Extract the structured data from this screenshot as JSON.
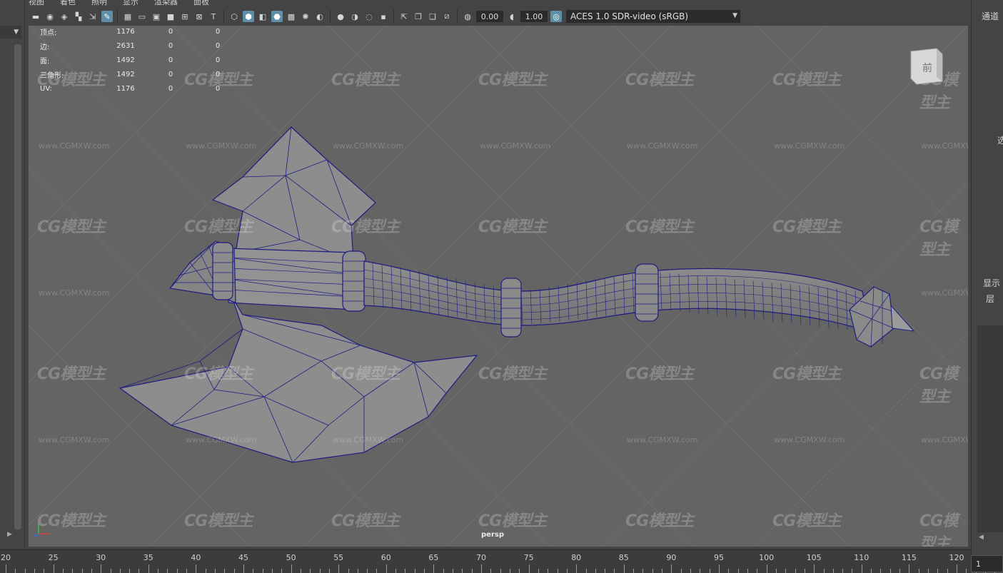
{
  "menu": [
    "视图",
    "着色",
    "照明",
    "显示",
    "渲染器",
    "面板"
  ],
  "toolbar": {
    "exposure": "0.00",
    "gamma": "1.00",
    "color_space": "ACES 1.0 SDR-video (sRGB)"
  },
  "hud": {
    "rows": [
      {
        "label": "顶点:",
        "v1": "1176",
        "v2": "0",
        "v3": "0"
      },
      {
        "label": "边:",
        "v1": "2631",
        "v2": "0",
        "v3": "0"
      },
      {
        "label": "面:",
        "v1": "1492",
        "v2": "0",
        "v3": "0"
      },
      {
        "label": "三角形:",
        "v1": "1492",
        "v2": "0",
        "v3": "0"
      },
      {
        "label": "UV:",
        "v1": "1176",
        "v2": "0",
        "v3": "0"
      }
    ]
  },
  "viewport": {
    "camera": "persp",
    "watermark": "CG模型主",
    "watermark_url": "www.CGMXW.com"
  },
  "right_panel": {
    "channels": "通道",
    "display": "显示",
    "layers": "层",
    "partial": "选"
  },
  "timeline": {
    "ticks": [
      "20",
      "25",
      "30",
      "35",
      "40",
      "45",
      "50",
      "55",
      "60",
      "65",
      "70",
      "75",
      "80",
      "85",
      "90",
      "95",
      "100",
      "105",
      "110",
      "115",
      "120"
    ],
    "current_frame": "1"
  },
  "colors": {
    "viewport_bg": "#646464",
    "mesh_fill": "#8b8b8b",
    "wire": "#1f1d80",
    "active_icon": "#5d8fa8"
  }
}
